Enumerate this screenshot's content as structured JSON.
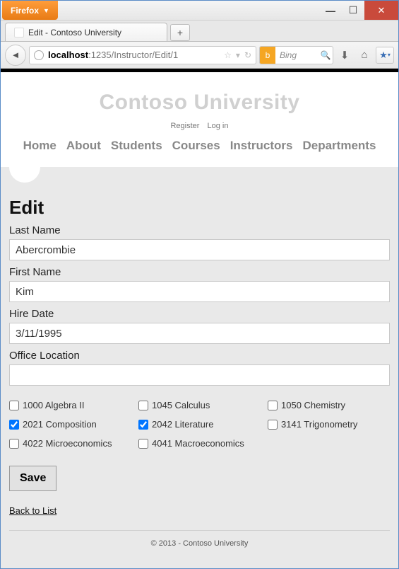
{
  "browser": {
    "name": "Firefox",
    "tab_title": "Edit - Contoso University",
    "url_host": "localhost",
    "url_path": ":1235/Instructor/Edit/1",
    "search_engine": "Bing"
  },
  "site": {
    "brand": "Contoso University",
    "auth": {
      "register": "Register",
      "login": "Log in"
    },
    "nav": [
      "Home",
      "About",
      "Students",
      "Courses",
      "Instructors",
      "Departments"
    ]
  },
  "page": {
    "heading": "Edit",
    "fields": {
      "last_name": {
        "label": "Last Name",
        "value": "Abercrombie"
      },
      "first_name": {
        "label": "First Name",
        "value": "Kim"
      },
      "hire_date": {
        "label": "Hire Date",
        "value": "3/11/1995"
      },
      "office_location": {
        "label": "Office Location",
        "value": ""
      }
    },
    "courses": [
      {
        "id": "1000",
        "title": "Algebra II",
        "checked": false
      },
      {
        "id": "1045",
        "title": "Calculus",
        "checked": false
      },
      {
        "id": "1050",
        "title": "Chemistry",
        "checked": false
      },
      {
        "id": "2021",
        "title": "Composition",
        "checked": true
      },
      {
        "id": "2042",
        "title": "Literature",
        "checked": true
      },
      {
        "id": "3141",
        "title": "Trigonometry",
        "checked": false
      },
      {
        "id": "4022",
        "title": "Microeconomics",
        "checked": false
      },
      {
        "id": "4041",
        "title": "Macroeconomics",
        "checked": false
      }
    ],
    "save_label": "Save",
    "back_link": "Back to List",
    "footer": "© 2013 - Contoso University"
  }
}
